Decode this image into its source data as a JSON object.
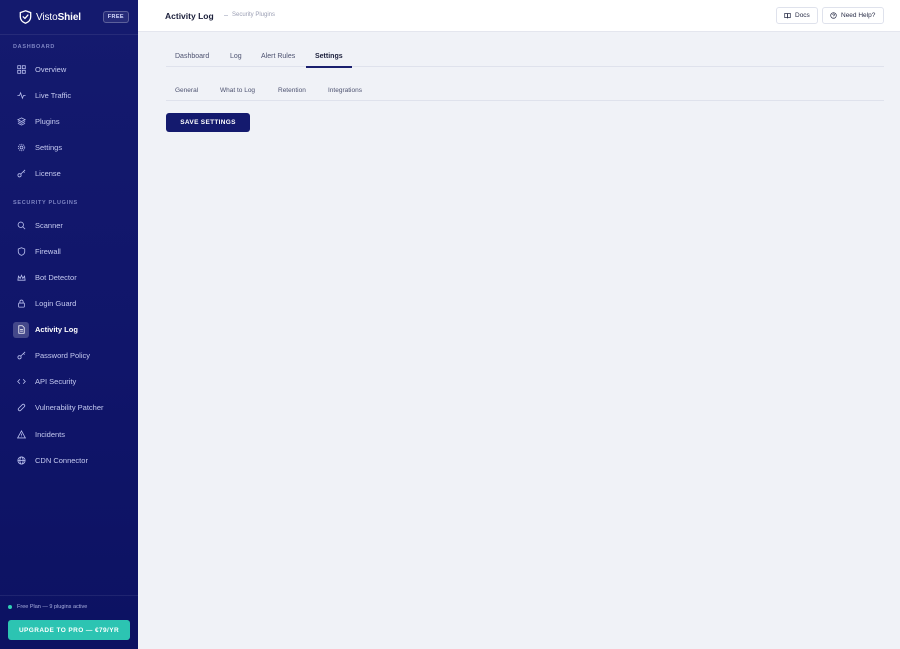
{
  "brand": {
    "name_light": "Visto",
    "name_bold": "Shiel",
    "name_tail": "l",
    "tier_badge": "FREE"
  },
  "sidebar": {
    "sections": [
      {
        "label": "DASHBOARD",
        "items": [
          {
            "label": "Overview",
            "icon": "grid-icon"
          },
          {
            "label": "Live Traffic",
            "icon": "activity-icon"
          },
          {
            "label": "Plugins",
            "icon": "layers-icon"
          },
          {
            "label": "Settings",
            "icon": "gear-icon"
          },
          {
            "label": "License",
            "icon": "key-icon"
          }
        ]
      },
      {
        "label": "SECURITY PLUGINS",
        "items": [
          {
            "label": "Scanner",
            "icon": "search-icon"
          },
          {
            "label": "Firewall",
            "icon": "shield-icon"
          },
          {
            "label": "Bot Detector",
            "icon": "bot-icon"
          },
          {
            "label": "Login Guard",
            "icon": "lock-icon"
          },
          {
            "label": "Activity Log",
            "icon": "document-icon",
            "active": true
          },
          {
            "label": "Password Policy",
            "icon": "key-icon"
          },
          {
            "label": "API Security",
            "icon": "code-icon"
          },
          {
            "label": "Vulnerability Patcher",
            "icon": "bandage-icon"
          },
          {
            "label": "Incidents",
            "icon": "alert-triangle-icon"
          },
          {
            "label": "CDN Connector",
            "icon": "globe-icon"
          }
        ]
      }
    ],
    "plan_status": "Free Plan — 9 plugins active",
    "upgrade_label": "UPGRADE TO PRO — €79/YR"
  },
  "header": {
    "title": "Activity Log",
    "breadcrumb": "Security Plugins",
    "docs_label": "Docs",
    "help_label": "Need Help?"
  },
  "tabs": [
    {
      "label": "Dashboard"
    },
    {
      "label": "Log"
    },
    {
      "label": "Alert Rules"
    },
    {
      "label": "Settings",
      "active": true
    }
  ],
  "subtabs": [
    {
      "label": "General"
    },
    {
      "label": "What to Log"
    },
    {
      "label": "Retention"
    },
    {
      "label": "Integrations"
    }
  ],
  "actions": {
    "save_label": "SAVE SETTINGS"
  },
  "colors": {
    "sidebar_bg": "#141a6e",
    "accent": "#141a6e",
    "upgrade": "#2cc4b2",
    "status_dot": "#2fd0b4"
  }
}
